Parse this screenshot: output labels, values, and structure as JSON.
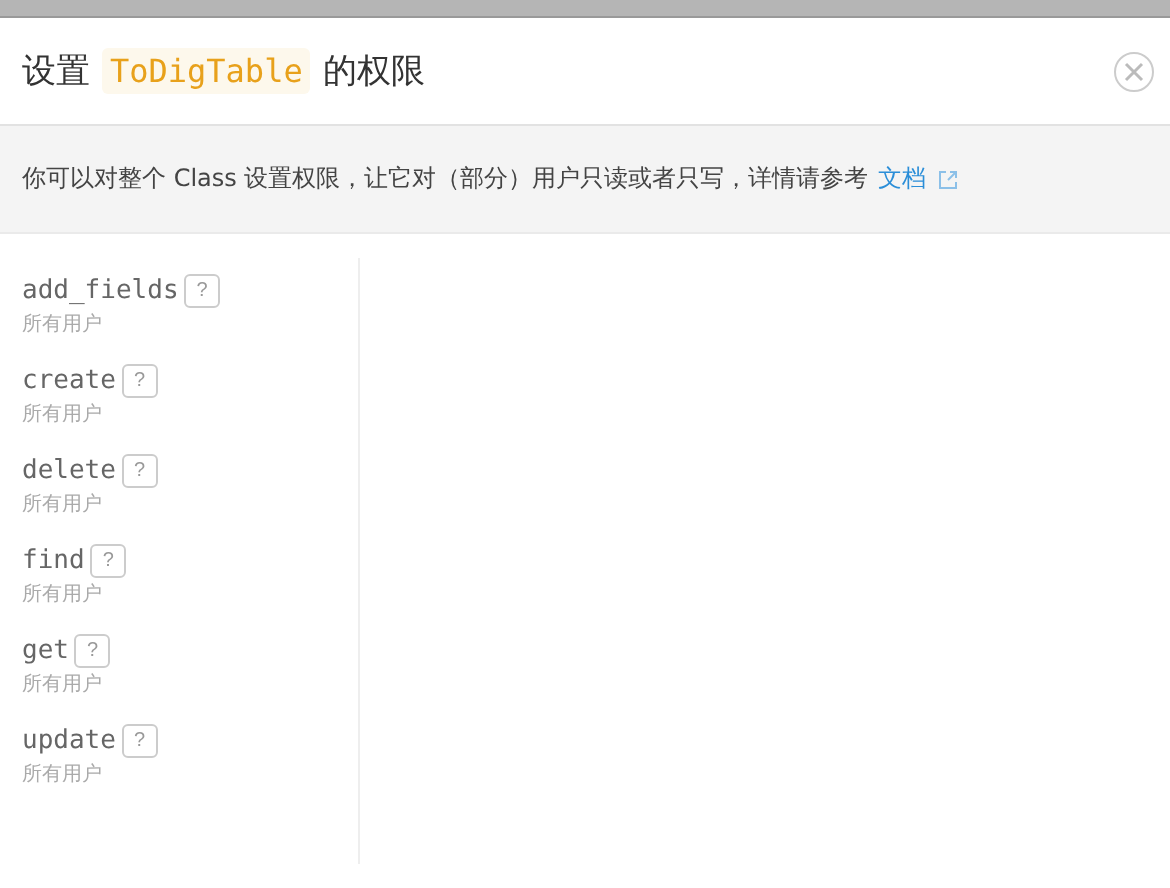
{
  "dialog": {
    "title_prefix": "设置",
    "class_name": "ToDigTable",
    "title_suffix": "的权限"
  },
  "notice": {
    "text": "你可以对整个 Class 设置权限，让它对（部分）用户只读或者只写，详情请参考",
    "link": "文档"
  },
  "permissions": [
    {
      "name": "add_fields",
      "help": "?",
      "scope": "所有用户"
    },
    {
      "name": "create",
      "help": "?",
      "scope": "所有用户"
    },
    {
      "name": "delete",
      "help": "?",
      "scope": "所有用户"
    },
    {
      "name": "find",
      "help": "?",
      "scope": "所有用户"
    },
    {
      "name": "get",
      "help": "?",
      "scope": "所有用户"
    },
    {
      "name": "update",
      "help": "?",
      "scope": "所有用户"
    }
  ]
}
